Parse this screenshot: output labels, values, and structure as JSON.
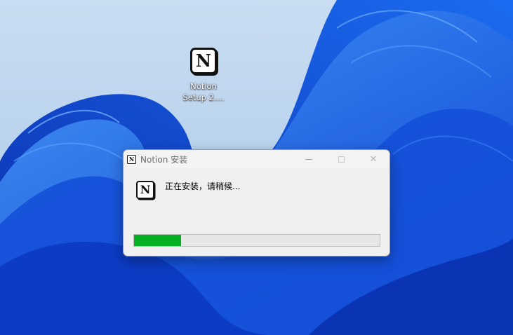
{
  "desktop": {
    "icon": {
      "name": "notion-logo",
      "label_line1": "Notion",
      "label_line2": "Setup 2...."
    }
  },
  "window": {
    "title": "Notion 安装",
    "title_icon": "notion-logo",
    "controls": [
      "minimize",
      "maximize",
      "close"
    ],
    "status_text": "正在安装，请稍候...",
    "progress_fraction": 0.19,
    "progress_color": "#06b025"
  },
  "colors": {
    "window_bg": "#f0f0f0",
    "wallpaper_blue": "#1a5fe0"
  }
}
